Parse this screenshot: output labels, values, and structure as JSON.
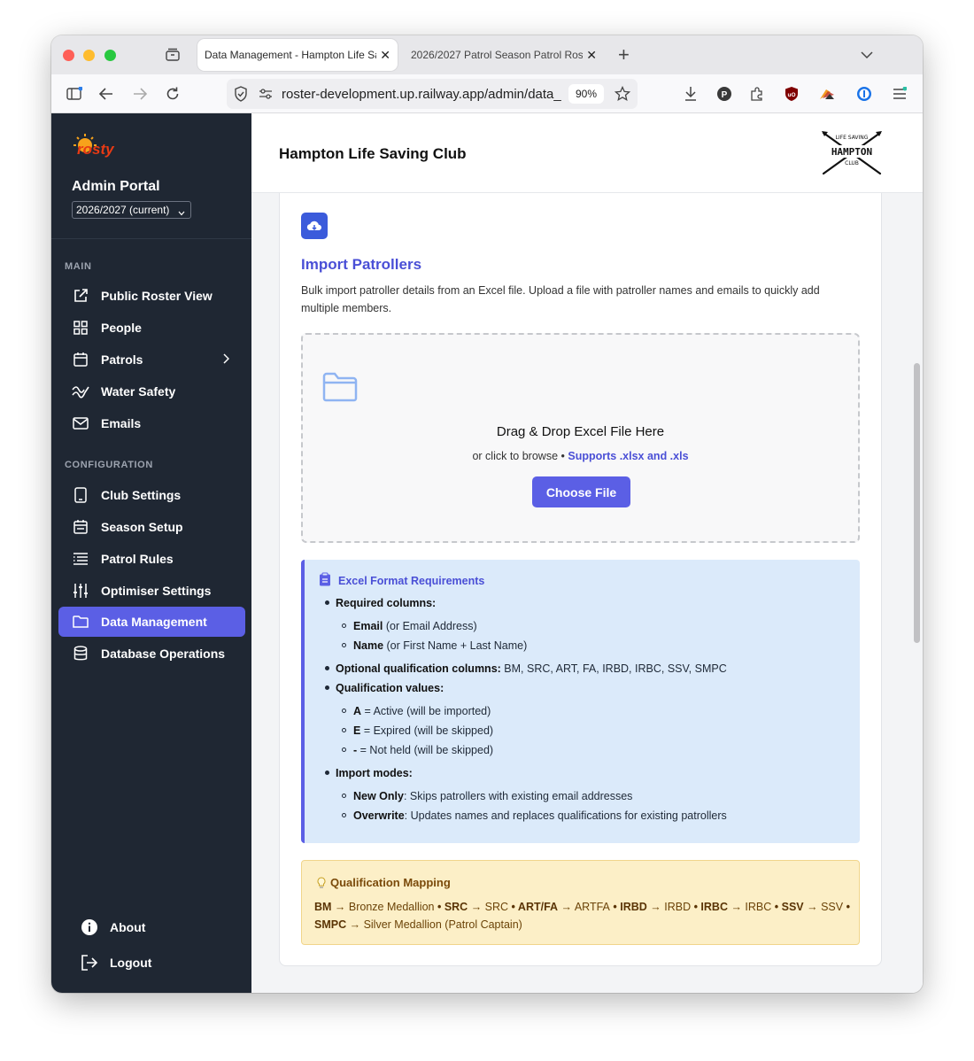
{
  "browser": {
    "tabs": [
      {
        "title": "Data Management - Hampton Life Sa",
        "close": "✕"
      },
      {
        "title": "2026/2027 Patrol Season Patrol Ros",
        "close": "✕"
      }
    ],
    "new_tab": "+",
    "url": "roster-development.up.railway.app/admin/data_",
    "zoom": "90%"
  },
  "sidebar": {
    "brand": "rosty",
    "portal_title": "Admin Portal",
    "season": "2026/2027 (current)",
    "main_label": "MAIN",
    "main_items": [
      {
        "label": "Public Roster View",
        "icon": "external-link-icon"
      },
      {
        "label": "People",
        "icon": "grid-icon"
      },
      {
        "label": "Patrols",
        "icon": "calendar-icon"
      },
      {
        "label": "Water Safety",
        "icon": "wave-icon"
      },
      {
        "label": "Emails",
        "icon": "mail-icon"
      }
    ],
    "config_label": "CONFIGURATION",
    "config_items": [
      {
        "label": "Club Settings",
        "icon": "tablet-icon"
      },
      {
        "label": "Season Setup",
        "icon": "calendar-icon"
      },
      {
        "label": "Patrol Rules",
        "icon": "list-icon"
      },
      {
        "label": "Optimiser Settings",
        "icon": "sliders-icon"
      },
      {
        "label": "Data Management",
        "icon": "folder-icon"
      },
      {
        "label": "Database Operations",
        "icon": "database-icon"
      }
    ],
    "active_item": "Data Management",
    "about": "About",
    "logout": "Logout"
  },
  "header": {
    "club_name": "Hampton Life Saving Club",
    "logo": {
      "top": "LIFE SAVING",
      "middle": "HAMPTON",
      "bottom": "CLUB"
    }
  },
  "import": {
    "title": "Import Patrollers",
    "description": "Bulk import patroller details from an Excel file. Upload a file with patroller names and emails to quickly add multiple members.",
    "dropzone_title": "Drag & Drop Excel File Here",
    "dropzone_sub": "or click to browse •",
    "dropzone_supports": "Supports .xlsx and .xls",
    "choose_file": "Choose File"
  },
  "requirements": {
    "title": "Excel Format Requirements",
    "required_columns": "Required columns:",
    "email_bold": "Email",
    "email_rest": " (or Email Address)",
    "name_bold": "Name",
    "name_rest": " (or First Name + Last Name)",
    "optional_bold": "Optional qualification columns:",
    "optional_rest": " BM, SRC, ART, FA, IRBD, IRBC, SSV, SMPC",
    "values_label": "Qualification values:",
    "a_bold": "A",
    "a_rest": " = Active (will be imported)",
    "e_bold": "E",
    "e_rest": " = Expired (will be skipped)",
    "dash_bold": "-",
    "dash_rest": " = Not held (will be skipped)",
    "modes_label": "Import modes:",
    "new_bold": "New Only",
    "new_rest": ": Skips patrollers with existing email addresses",
    "overwrite_bold": "Overwrite",
    "overwrite_rest": ": Updates names and replaces qualifications for existing patrollers"
  },
  "mapping": {
    "title": "Qualification Mapping",
    "items": [
      {
        "code": "BM",
        "name": "Bronze Medallion"
      },
      {
        "code": "SRC",
        "name": "SRC"
      },
      {
        "code": "ART/FA",
        "name": "ARTFA"
      },
      {
        "code": "IRBD",
        "name": "IRBD"
      },
      {
        "code": "IRBC",
        "name": "IRBC"
      },
      {
        "code": "SSV",
        "name": "SSV"
      },
      {
        "code": "SMPC",
        "name": "Silver Medallion (Patrol Captain)"
      }
    ],
    "arrow": " → ",
    "separator": " • "
  },
  "colors": {
    "accent": "#5b5fe5",
    "sidebar_bg": "#1f2733",
    "info_bg": "#dbeafa",
    "warn_bg": "#fcefc7"
  }
}
